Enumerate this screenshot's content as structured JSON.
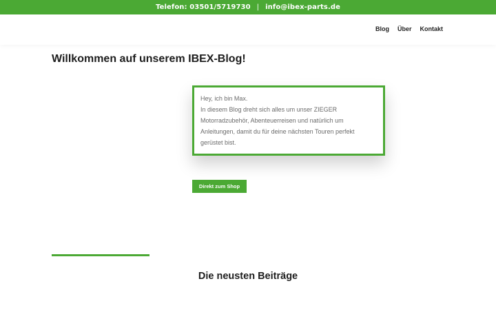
{
  "topbar": {
    "phone": "Telefon: 03501/5719730",
    "separator": "|",
    "email": "info@ibex-parts.de"
  },
  "nav": {
    "items": [
      "Blog",
      "Über",
      "Kontakt"
    ]
  },
  "page": {
    "title": "Willkommen auf unserem IBEX-Blog!"
  },
  "intro": {
    "lines": [
      "Hey, ich bin Max.",
      "In diesem Blog dreht sich alles um unser ZIEGER Motorradzubehör, Abenteuerreisen und natürlich um Anleitungen, damit du für deine nächsten Touren perfekt gerüstet bist."
    ]
  },
  "shop_button": {
    "label": "Direkt zum Shop"
  },
  "latest": {
    "title": "Die neusten Beiträge"
  },
  "colors": {
    "accent": "#4ba934",
    "text": "#1d1d1d",
    "muted_text": "#6b6b6b"
  }
}
